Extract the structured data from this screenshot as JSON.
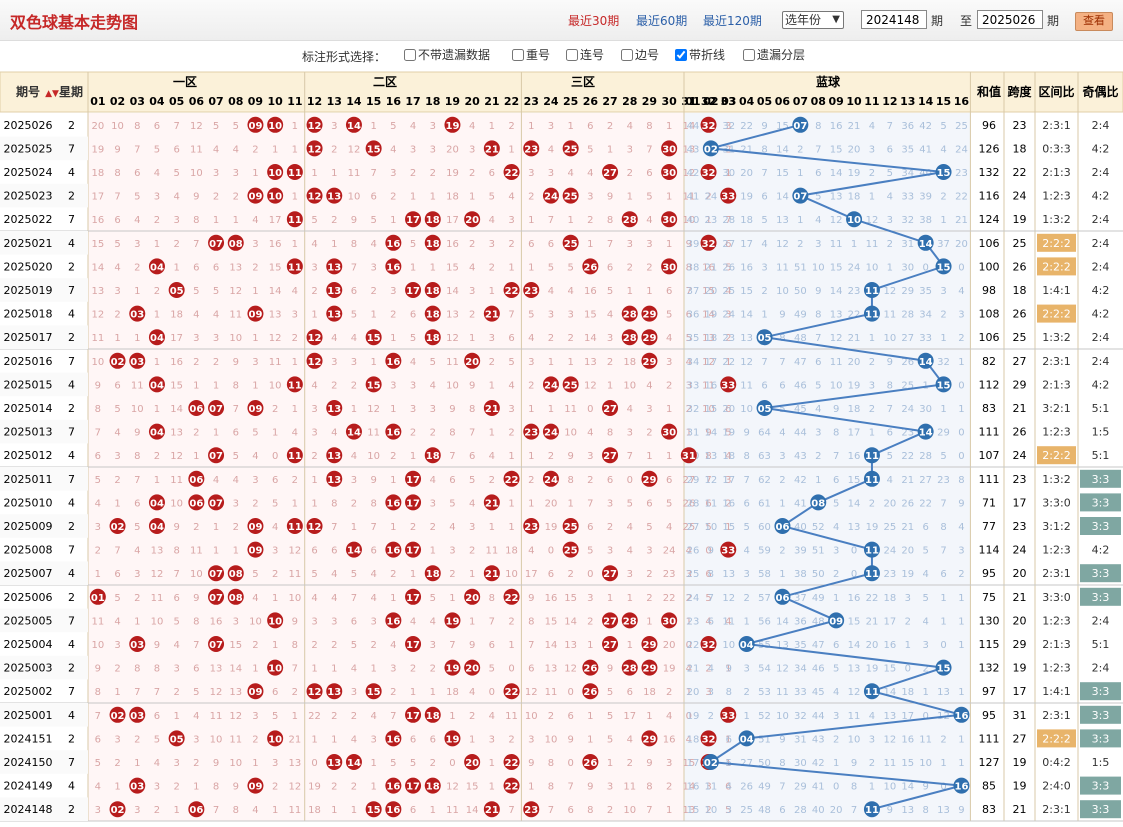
{
  "app_title": "双色球基本走势图",
  "toolbar": {
    "links": [
      "最近30期",
      "最近60期",
      "最近120期"
    ],
    "active_link_index": 0,
    "year_select": "选年份",
    "from_issue": "2024148",
    "period_label": "期",
    "to_label": "至",
    "to_issue": "2025026",
    "view_button": "查看"
  },
  "options": {
    "label": "标注形式选择：",
    "items": [
      {
        "label": "不带遗漏数据",
        "checked": false
      },
      {
        "label": "重号",
        "checked": false
      },
      {
        "label": "连号",
        "checked": false
      },
      {
        "label": "边号",
        "checked": false
      },
      {
        "label": "带折线",
        "checked": true
      },
      {
        "label": "遗漏分层",
        "checked": false
      }
    ]
  },
  "table_header": {
    "issue": "期号",
    "weekday": "星期",
    "zone1": "一区",
    "zone2": "二区",
    "zone3": "三区",
    "blue": "蓝球",
    "sum": "和值",
    "span": "跨度",
    "zone_ratio": "区间比",
    "odd_even": "奇偶比",
    "red_numbers": [
      "01",
      "02",
      "03",
      "04",
      "05",
      "06",
      "07",
      "08",
      "09",
      "10",
      "11",
      "12",
      "13",
      "14",
      "15",
      "16",
      "17",
      "18",
      "19",
      "20",
      "21",
      "22",
      "23",
      "24",
      "25",
      "26",
      "27",
      "28",
      "29",
      "30",
      "31",
      "32",
      "33"
    ],
    "blue_numbers": [
      "01",
      "02",
      "03",
      "04",
      "05",
      "06",
      "07",
      "08",
      "09",
      "10",
      "11",
      "12",
      "13",
      "14",
      "15",
      "16"
    ]
  },
  "colors": {
    "red_ball": "#b71c1c",
    "blue_ball": "#2f6fae",
    "trend_line": "#4a7fc1",
    "highlight_ratio": "#e8b46a",
    "odd_even_highlight": "#7fa7a2",
    "title": "#c62828"
  },
  "rows": [
    {
      "issue": "2025026",
      "weekday": "2",
      "reds": [
        9,
        10,
        12,
        14,
        19,
        32
      ],
      "blue": 7,
      "sum": "96",
      "span": "23",
      "ratio": "2:3:1",
      "oe": "2:4",
      "miss_r": "20 10 8 6 7 12 5 5 0 0 1 0 3 0 1 5 4 3 0 4 1 2 1 3 1 6 2 4 8 1 14 0 3",
      "miss_b": "44 1 32 22 9 15 0 8 16 21 4 7 36 42 5 25"
    },
    {
      "issue": "2025025",
      "weekday": "7",
      "reds": [
        12,
        15,
        21,
        23,
        25,
        30
      ],
      "blue": 2,
      "sum": "126",
      "span": "18",
      "ratio": "0:3:3",
      "oe": "4:2",
      "miss_r": "19 9 7 5 6 11 4 4 2 1 1 0 2 12 0 4 3 3 20 3 0 1 0 4 0 5 1 3 7 0 13 1 2",
      "miss_b": "43 0 31 21 8 14 2 7 15 20 3 6 35 41 4 24"
    },
    {
      "issue": "2025024",
      "weekday": "4",
      "reds": [
        10,
        11,
        22,
        27,
        30,
        32
      ],
      "blue": 15,
      "sum": "132",
      "span": "22",
      "ratio": "2:1:3",
      "oe": "2:4",
      "miss_r": "18 8 6 4 5 10 3 3 1 0 0 1 1 11 7 3 2 2 19 2 6 0 3 3 4 4 0 2 6 0 12 0 1",
      "miss_b": "42 35 30 20 7 15 1 6 14 19 2 5 34 40 0 23"
    },
    {
      "issue": "2025023",
      "weekday": "2",
      "reds": [
        9,
        10,
        12,
        13,
        24,
        25,
        33
      ],
      "blue": 7,
      "sum": "116",
      "span": "24",
      "ratio": "1:2:3",
      "oe": "4:2",
      "miss_r": "17 7 5 3 4 9 2 2 0 0 1 0 0 10 6 2 1 1 18 1 5 4 2 0 0 3 9 1 5 1 11 2 0",
      "miss_b": "41 24 29 19 6 14 0 5 13 18 1 4 33 39 2 22"
    },
    {
      "issue": "2025022",
      "weekday": "7",
      "reds": [
        11,
        17,
        18,
        20,
        28,
        30
      ],
      "blue": 10,
      "sum": "124",
      "span": "19",
      "ratio": "1:3:2",
      "oe": "2:4",
      "miss_r": "16 6 4 2 3 8 1 1 4 17 0 5 2 9 5 1 0 0 17 0 4 3 1 7 1 2 8 0 4 0 10 1 7",
      "miss_b": "40 23 28 18 5 13 1 4 12 0 12 3 32 38 1 21"
    },
    {
      "issue": "2025021",
      "weekday": "4",
      "reds": [
        7,
        8,
        16,
        18,
        25,
        32
      ],
      "blue": 14,
      "sum": "106",
      "span": "25",
      "ratio": "2:2:2",
      "oe": "2:4",
      "miss_r": "15 5 3 1 2 7 0 0 3 16 1 4 1 8 4 0 5 0 16 2 3 2 6 6 0 1 7 3 3 1 9 0 6",
      "miss_b": "39 22 27 17 4 12 2 3 11 1 11 2 31 0 37 20"
    },
    {
      "issue": "2025020",
      "weekday": "2",
      "reds": [
        4,
        11,
        13,
        16,
        26,
        30
      ],
      "blue": 15,
      "sum": "100",
      "span": "26",
      "ratio": "2:2:2",
      "oe": "2:4",
      "miss_r": "14 4 2 0 1 6 6 13 2 15 0 3 0 7 3 0 1 1 15 4 2 1 1 5 5 0 6 2 2 0 8 16 5",
      "miss_b": "38 21 26 16 3 11 51 10 15 24 10 1 30 0 36 0"
    },
    {
      "issue": "2025019",
      "weekday": "7",
      "reds": [
        5,
        13,
        17,
        18,
        22,
        23
      ],
      "blue": 11,
      "sum": "98",
      "span": "18",
      "ratio": "1:4:1",
      "oe": "4:2",
      "miss_r": "13 3 1 2 0 5 5 12 1 14 4 2 0 6 2 3 0 0 14 3 1 0 0 4 4 16 5 1 1 6 7 15 4",
      "miss_b": "37 20 25 15 2 10 50 9 14 23 0 12 29 35 3 4"
    },
    {
      "issue": "2025018",
      "weekday": "4",
      "reds": [
        3,
        9,
        13,
        18,
        21,
        28,
        29
      ],
      "blue": 11,
      "sum": "108",
      "span": "26",
      "ratio": "2:2:2",
      "oe": "4:2",
      "miss_r": "12 2 0 1 18 4 4 11 0 13 3 1 0 5 1 2 6 0 13 2 0 7 5 3 3 15 4 0 0 5 6 14 3",
      "miss_b": "36 19 24 14 1 9 49 8 13 22 0 11 28 34 2 3"
    },
    {
      "issue": "2025017",
      "weekday": "2",
      "reds": [
        4,
        12,
        15,
        18,
        28,
        29
      ],
      "blue": 5,
      "sum": "106",
      "span": "25",
      "ratio": "1:3:2",
      "oe": "2:4",
      "miss_r": "11 1 1 0 17 3 3 10 1 12 2 0 4 4 0 1 5 0 12 1 3 6 4 2 2 14 3 0 0 4 5 13 2",
      "miss_b": "35 18 23 13 0 8 48 7 12 21 1 10 27 33 1 2"
    },
    {
      "issue": "2025016",
      "weekday": "7",
      "reds": [
        2,
        3,
        12,
        16,
        20,
        29
      ],
      "blue": 14,
      "sum": "82",
      "span": "27",
      "ratio": "2:3:1",
      "oe": "2:4",
      "miss_r": "10 0 0 1 16 2 2 9 3 11 1 0 3 3 1 0 4 5 11 0 2 5 3 1 1 13 2 18 0 3 4 12 1",
      "miss_b": "34 17 22 12 7 7 47 6 11 20 2 9 26 0 32 1"
    },
    {
      "issue": "2025015",
      "weekday": "4",
      "reds": [
        4,
        11,
        15,
        24,
        25,
        33
      ],
      "blue": 15,
      "sum": "112",
      "span": "29",
      "ratio": "2:1:3",
      "oe": "4:2",
      "miss_r": "9 6 11 0 15 1 1 8 1 10 0 4 2 2 0 3 3 4 10 9 1 4 2 0 0 12 1 10 4 2 3 11 0",
      "miss_b": "33 16 21 11 6 6 46 5 10 19 3 8 25 1 0 0"
    },
    {
      "issue": "2025014",
      "weekday": "2",
      "reds": [
        6,
        7,
        9,
        13,
        21,
        27
      ],
      "blue": 5,
      "sum": "83",
      "span": "21",
      "ratio": "3:2:1",
      "oe": "5:1",
      "miss_r": "8 5 10 1 14 0 0 7 0 2 1 3 0 1 12 1 3 3 9 8 0 3 1 1 11 0 1 4 3 1 2 10 6",
      "miss_b": "32 15 20 10 0 5 45 4 9 18 2 7 24 30 1 1"
    },
    {
      "issue": "2025013",
      "weekday": "7",
      "reds": [
        4,
        14,
        16,
        23,
        24,
        30
      ],
      "blue": 14,
      "sum": "111",
      "span": "26",
      "ratio": "1:2:3",
      "oe": "1:5",
      "miss_r": "7 4 9 0 13 2 1 6 5 1 4 3 4 0 11 0 2 2 8 7 1 2 0 0 10 4 8 3 2 0 1 9 5",
      "miss_b": "31 14 19 9 64 4 44 3 8 17 1 6 23 0 29 0"
    },
    {
      "issue": "2025012",
      "weekday": "4",
      "reds": [
        7,
        11,
        13,
        18,
        27,
        31
      ],
      "blue": 11,
      "sum": "107",
      "span": "24",
      "ratio": "2:2:2",
      "oe": "5:1",
      "miss_r": "6 3 8 2 12 1 0 5 4 0 0 2 0 4 10 2 1 0 7 6 4 1 1 2 9 3 0 7 1 1 0 8 4",
      "miss_b": "30 13 18 8 63 3 43 2 7 16 0 5 22 28 5 0"
    },
    {
      "issue": "2025011",
      "weekday": "7",
      "reds": [
        6,
        13,
        17,
        22,
        24,
        29
      ],
      "blue": 11,
      "sum": "111",
      "span": "23",
      "ratio": "1:3:2",
      "oe": "3:3",
      "miss_r": "5 2 7 1 11 0 4 4 3 6 2 1 0 3 9 1 0 4 6 5 2 0 2 0 8 2 6 0 0 6 27 7 3",
      "miss_b": "29 12 17 7 62 2 42 1 6 15 0 4 21 27 23 8"
    },
    {
      "issue": "2025010",
      "weekday": "4",
      "reds": [
        4,
        6,
        7,
        16,
        17,
        21
      ],
      "blue": 8,
      "sum": "71",
      "span": "17",
      "ratio": "3:3:0",
      "oe": "3:3",
      "miss_r": "4 1 6 0 10 0 0 3 2 5 1 1 8 2 8 0 0 3 5 4 0 1 1 20 1 7 3 5 6 5 26 6 2",
      "miss_b": "28 11 16 6 61 1 41 0 5 14 2 20 26 22 7 9"
    },
    {
      "issue": "2025009",
      "weekday": "2",
      "reds": [
        2,
        4,
        9,
        11,
        12,
        23,
        25
      ],
      "blue": 6,
      "sum": "77",
      "span": "23",
      "ratio": "3:1:2",
      "oe": "3:3",
      "miss_r": "3 0 5 0 9 2 1 2 0 4 0 0 7 1 7 1 2 2 4 3 1 1 0 19 0 6 2 4 5 4 25 5 1",
      "miss_b": "27 10 15 5 60 0 40 52 4 13 19 25 21 6 8 4"
    },
    {
      "issue": "2025008",
      "weekday": "7",
      "reds": [
        9,
        14,
        16,
        17,
        25,
        33
      ],
      "blue": 11,
      "sum": "114",
      "span": "24",
      "ratio": "1:2:3",
      "oe": "4:2",
      "miss_r": "2 7 4 13 8 11 1 1 0 3 12 6 6 0 6 0 0 1 3 2 11 18 4 0 1 5 3 4 3 24 4 0",
      "miss_b": "26 9 14 4 59 2 39 51 3 0 18 24 20 5 7 3"
    },
    {
      "issue": "2025007",
      "weekday": "4",
      "reds": [
        7,
        8,
        18,
        21,
        27
      ],
      "blue": 11,
      "sum": "95",
      "span": "20",
      "ratio": "2:3:1",
      "oe": "3:3",
      "miss_r": "1 6 3 12 7 10 0 0 5 2 11 5 4 5 4 2 1 0 2 1 0 10 17 6 2 0 2 3 2 23 3 6",
      "miss_b": "25 8 13 3 58 1 38 50 2 0 17 23 19 4 6 2"
    },
    {
      "issue": "2025006",
      "weekday": "2",
      "reds": [
        1,
        7,
        8,
        17,
        20,
        22
      ],
      "blue": 6,
      "sum": "75",
      "span": "21",
      "ratio": "3:3:0",
      "oe": "3:3",
      "miss_r": "0 5 2 11 6 9 0 0 4 1 10 4 4 7 4 1 0 5 1 0 8 0 9 16 15 3 1 1 2 22 2 5",
      "miss_b": "24 7 12 2 57 0 37 49 1 16 22 18 3 5 1 1"
    },
    {
      "issue": "2025005",
      "weekday": "7",
      "reds": [
        10,
        16,
        19,
        27,
        28,
        30
      ],
      "blue": 9,
      "sum": "130",
      "span": "20",
      "ratio": "1:2:3",
      "oe": "2:4",
      "miss_r": "11 4 1 10 5 8 16 3 10 0 9 3 3 6 3 0 4 4 0 1 7 2 8 15 14 2 0 0 1 0 1 4 4",
      "miss_b": "23 6 11 1 56 14 36 48 0 15 21 17 2 4 1 1"
    },
    {
      "issue": "2025004",
      "weekday": "4",
      "reds": [
        3,
        7,
        17,
        27,
        29,
        32
      ],
      "blue": 4,
      "sum": "115",
      "span": "29",
      "ratio": "2:1:3",
      "oe": "5:1",
      "miss_r": "10 3 0 9 4 7 0 15 2 1 8 2 2 5 2 4 0 3 7 9 6 1 7 14 13 1 0 1 0 20 0 3",
      "miss_b": "22 5 10 0 55 13 35 47 6 14 20 16 1 3 0 1"
    },
    {
      "issue": "2025003",
      "weekday": "2",
      "reds": [
        10,
        19,
        20,
        26,
        28,
        29
      ],
      "blue": 15,
      "sum": "132",
      "span": "19",
      "ratio": "1:2:3",
      "oe": "2:4",
      "miss_r": "9 2 8 8 3 6 13 14 1 0 7 1 1 4 1 3 2 2 0 0 5 0 6 13 12 0 9 0 0 19 4 2 1",
      "miss_b": "21 4 9 3 54 12 34 46 5 13 19 15 0 2 0"
    },
    {
      "issue": "2025002",
      "weekday": "7",
      "reds": [
        9,
        12,
        13,
        15,
        22,
        26
      ],
      "blue": 11,
      "sum": "97",
      "span": "17",
      "ratio": "1:4:1",
      "oe": "3:3",
      "miss_r": "8 1 7 7 2 5 12 13 0 6 2 0 0 3 0 2 1 1 18 4 0 5 12 11 0 2 5 6 18 2 1 3",
      "miss_b": "20 3 8 2 53 11 33 45 4 12 0 14 18 1 13 1"
    },
    {
      "issue": "2025001",
      "weekday": "4",
      "reds": [
        2,
        3,
        17,
        18,
        33
      ],
      "blue": 16,
      "sum": "95",
      "span": "31",
      "ratio": "2:3:1",
      "oe": "3:3",
      "miss_r": "7 0 0 6 1 4 11 12 3 5 1 22 2 2 4 7 0 0 1 2 4 11 10 2 6 1 5 17 1 4 0",
      "miss_b": "19 2 7 1 52 10 32 44 3 11 4 13 17 0 12 0"
    },
    {
      "issue": "2024151",
      "weekday": "2",
      "reds": [
        5,
        10,
        16,
        19,
        29,
        32
      ],
      "blue": 4,
      "sum": "111",
      "span": "27",
      "ratio": "2:2:2",
      "oe": "3:3",
      "miss_r": "6 3 2 5 0 3 10 11 2 0 21 1 1 4 3 0 6 6 0 1 3 2 3 10 9 1 5 4 0 16 4 0 1",
      "miss_b": "18 1 6 0 51 9 31 43 2 10 3 12 16 11 2 1"
    },
    {
      "issue": "2024150",
      "weekday": "7",
      "reds": [
        13,
        14,
        20,
        22,
        26,
        32
      ],
      "blue": 2,
      "sum": "127",
      "span": "19",
      "ratio": "0:4:2",
      "oe": "1:5",
      "miss_r": "5 2 1 4 3 2 9 10 1 3 13 0 0 2 1 5 5 2 0 2 1 0 9 8 0 4 1 2 9 3 15 0 1",
      "miss_b": "17 0 5 27 50 8 30 42 1 9 2 11 15 10 1 1"
    },
    {
      "issue": "2024149",
      "weekday": "4",
      "reds": [
        3,
        9,
        16,
        17,
        18,
        22
      ],
      "blue": 16,
      "sum": "85",
      "span": "19",
      "ratio": "2:4:0",
      "oe": "3:3",
      "miss_r": "4 1 0 3 2 1 8 9 0 2 12 19 2 2 1 0 0 0 12 15 1 0 1 8 7 9 3 11 8 2 14 3 6",
      "miss_b": "16 11 4 26 49 7 29 41 0 8 1 10 14 9 0 0"
    },
    {
      "issue": "2024148",
      "weekday": "2",
      "reds": [
        2,
        6,
        15,
        16,
        21,
        23
      ],
      "blue": 11,
      "sum": "83",
      "span": "21",
      "ratio": "2:3:1",
      "oe": "3:3",
      "miss_r": "3 0 3 2 1 0 7 8 4 1 11 18 1 1 0 0 6 1 11 14 0 7 0 7 6 8 2 10 7 1 13 2 5",
      "miss_b": "15 10 3 25 48 6 28 40 20 7 0 9 13 8 13 9"
    }
  ]
}
